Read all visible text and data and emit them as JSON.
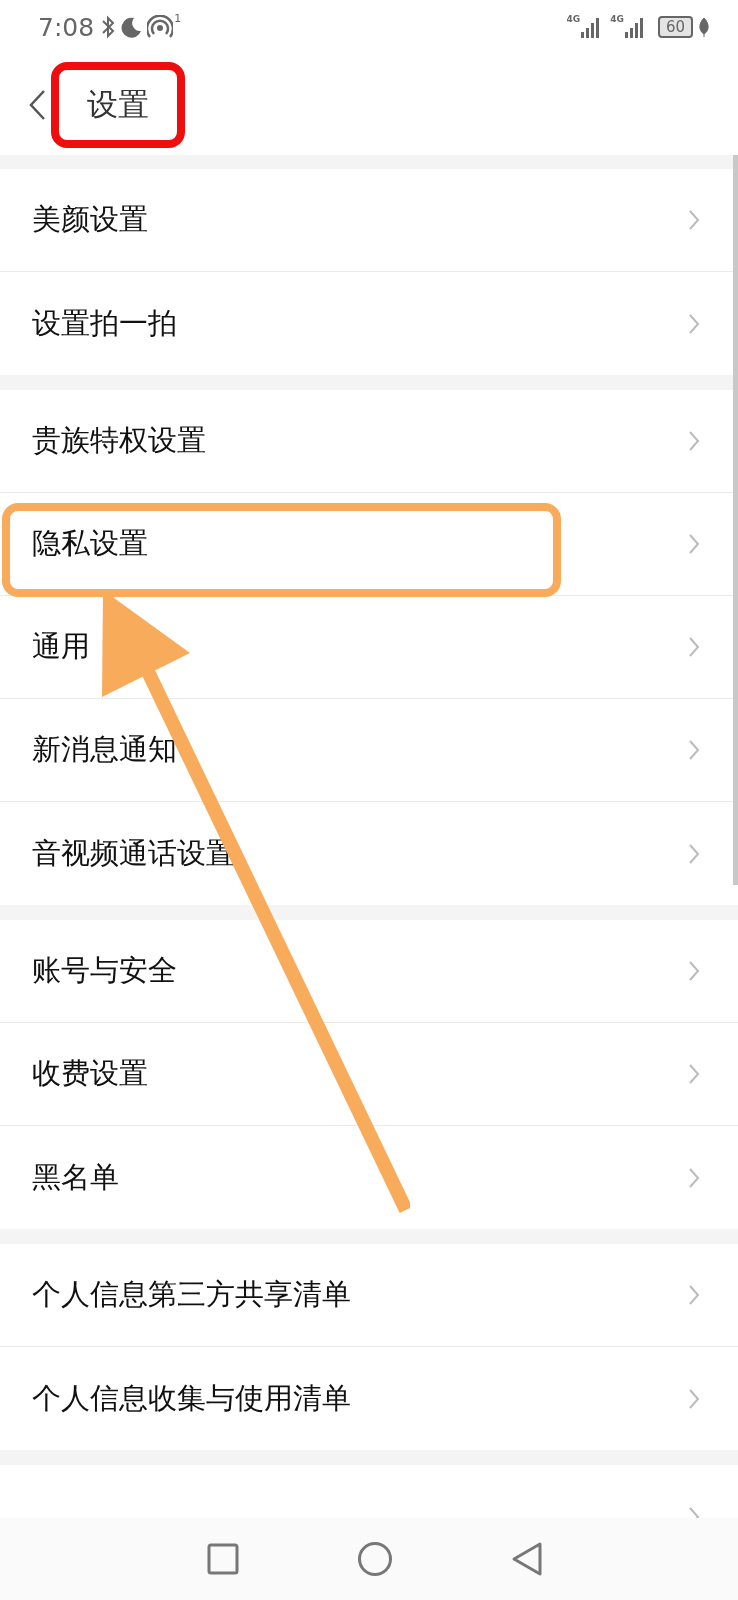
{
  "status_bar": {
    "time": "7:08",
    "hotspot_count": "1",
    "networks": [
      "4G",
      "4G"
    ],
    "battery": "60"
  },
  "header": {
    "title": "设置",
    "title_highlighted": true
  },
  "groups": [
    [
      {
        "label": "美颜设置",
        "highlighted": false
      },
      {
        "label": "设置拍一拍",
        "highlighted": false
      }
    ],
    [
      {
        "label": "贵族特权设置",
        "highlighted": false
      },
      {
        "label": "隐私设置",
        "highlighted": true
      },
      {
        "label": "通用",
        "highlighted": false
      },
      {
        "label": "新消息通知",
        "highlighted": false
      },
      {
        "label": "音视频通话设置",
        "highlighted": false
      }
    ],
    [
      {
        "label": "账号与安全",
        "highlighted": false
      },
      {
        "label": "收费设置",
        "highlighted": false
      },
      {
        "label": "黑名单",
        "highlighted": false
      }
    ],
    [
      {
        "label": "个人信息第三方共享清单",
        "highlighted": false
      },
      {
        "label": "个人信息收集与使用清单",
        "highlighted": false
      }
    ],
    [
      {
        "highlighted": false
      }
    ]
  ],
  "annotation_arrow": {
    "color": "#f9ab5c"
  }
}
